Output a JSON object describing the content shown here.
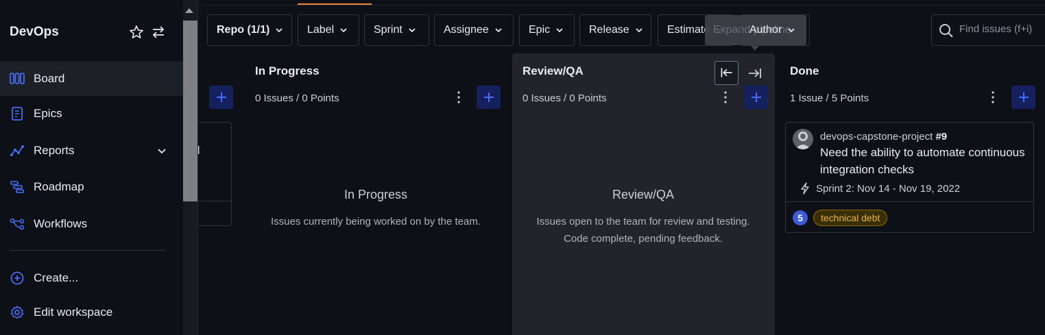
{
  "sidebar": {
    "brand": "DevOps",
    "items": [
      {
        "label": "Board",
        "icon": "board-icon",
        "active": true
      },
      {
        "label": "Epics",
        "icon": "epics-icon"
      },
      {
        "label": "Reports",
        "icon": "reports-icon"
      },
      {
        "label": "Roadmap",
        "icon": "roadmap-icon"
      },
      {
        "label": "Workflows",
        "icon": "workflows-icon"
      }
    ],
    "actions": [
      {
        "label": "Create...",
        "icon": "plus-circle-icon"
      },
      {
        "label": "Edit workspace",
        "icon": "gear-icon"
      }
    ]
  },
  "filters": {
    "repo": "Repo (1/1)",
    "label": "Label",
    "sprint": "Sprint",
    "assignee": "Assignee",
    "epic": "Epic",
    "release": "Release",
    "estimate": "Estimate",
    "author": "Author"
  },
  "search": {
    "placeholder": "Find issues (f+i)"
  },
  "tooltip": "Expand pipeline",
  "columns": [
    {
      "title": "In Progress",
      "count": "0 Issues / 0 Points",
      "empty_title": "In Progress",
      "empty_desc": "Issues currently being worked on by the team."
    },
    {
      "title": "Review/QA",
      "count": "0 Issues / 0 Points",
      "empty_title": "Review/QA",
      "empty_desc": "Issues open to the team for review and testing. Code complete, pending feedback."
    },
    {
      "title": "Done",
      "count": "1 Issue / 5 Points"
    }
  ],
  "partial_card_text": "d",
  "card": {
    "repo": "devops-capstone-project",
    "number": "#9",
    "title": "Need the ability to automate continuous integration checks",
    "sprint": "Sprint 2: Nov 14 - Nov 19, 2022",
    "points": "5",
    "label": "technical debt"
  },
  "colors": {
    "accent": "#4a6cf7",
    "add_button_bg": "#14215e",
    "label_text": "#e3b341",
    "active_tab": "#f0883e"
  }
}
